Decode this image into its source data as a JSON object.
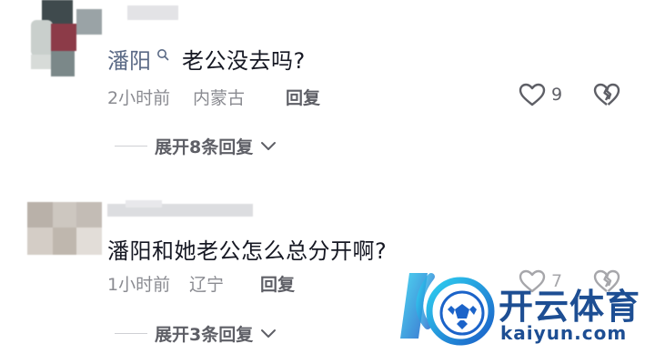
{
  "comments": [
    {
      "name": "潘阳",
      "text": "老公没去吗?",
      "time": "2小时前",
      "location": "内蒙古",
      "reply_label": "回复",
      "like_count": "9",
      "expand_label": "展开8条回复"
    },
    {
      "name": "",
      "text": "潘阳和她老公怎么总分开啊?",
      "time": "1小时前",
      "location": "辽宁",
      "reply_label": "回复",
      "like_count": "7",
      "expand_label": "展开3条回复"
    }
  ],
  "watermark": {
    "brand_cn": "开云体育",
    "brand_en": "kaiyun.com"
  },
  "colors": {
    "name": "#5b6a86",
    "text": "#161823",
    "meta": "#8a8b91",
    "accent_blue": "#1e6fd1"
  }
}
